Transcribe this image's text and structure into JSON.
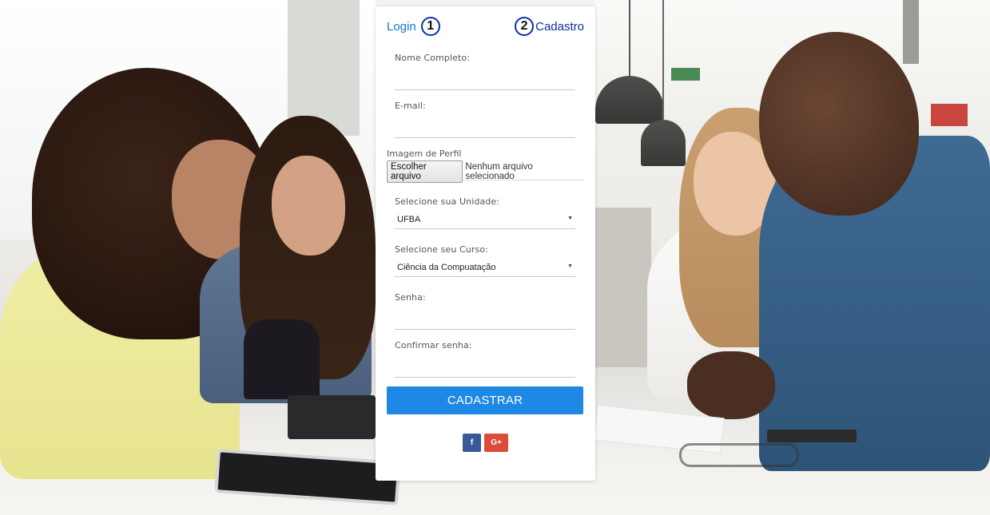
{
  "tabs": {
    "login_label": "Login",
    "login_step": "1",
    "cadastro_step": "2",
    "cadastro_label": "Cadastro"
  },
  "form": {
    "nome": {
      "label": "Nome Completo:",
      "value": ""
    },
    "email": {
      "label": "E-mail:",
      "value": ""
    },
    "imagem": {
      "label": "Imagem de Perfil",
      "button_label": "Escolher arquivo",
      "status": "Nenhum arquivo selecionado"
    },
    "unidade": {
      "label": "Selecione sua Unidade:",
      "selected": "UFBA"
    },
    "curso": {
      "label": "Selecione seu Curso:",
      "selected": "Ciência da Compuatação"
    },
    "senha": {
      "label": "Senha:",
      "value": ""
    },
    "confirmar": {
      "label": "Confirmar senha:",
      "value": ""
    },
    "submit_label": "CADASTRAR"
  },
  "social": {
    "facebook": {
      "glyph": "f",
      "icon": "facebook-icon",
      "color": "#3b5998"
    },
    "google": {
      "glyph": "G+",
      "icon": "google-plus-icon",
      "color": "#dd4b39"
    }
  },
  "colors": {
    "accent": "#1e88e5",
    "tab_login": "#1877c8",
    "tab_cadastro": "#0d2f9c"
  }
}
